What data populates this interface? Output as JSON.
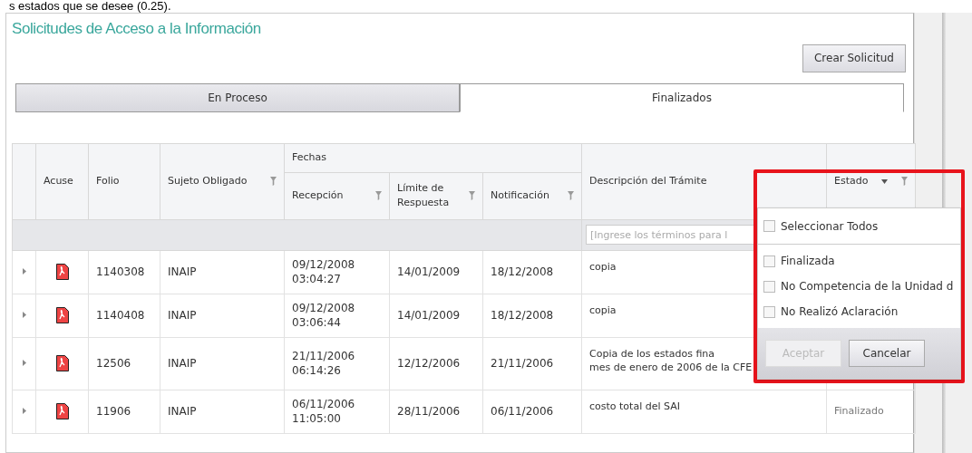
{
  "top_text": "s estados que se desee (0.25).",
  "title": "Solicitudes de Acceso a la Información",
  "create_button": "Crear Solicitud",
  "tabs": [
    {
      "label": "En Proceso",
      "selected": false
    },
    {
      "label": "Finalizados",
      "selected": true
    }
  ],
  "table": {
    "group_header": "Fechas",
    "columns": [
      {
        "label": "Acuse",
        "filter": false
      },
      {
        "label": "Folio",
        "filter": false
      },
      {
        "label": "Sujeto Obligado",
        "filter": true
      },
      {
        "label": "Recepción",
        "filter": true,
        "group": true
      },
      {
        "label": "Límite de Respuesta",
        "filter": true,
        "group": true
      },
      {
        "label": "Notificación",
        "filter": true,
        "group": true
      },
      {
        "label": "Descripción del Trámite",
        "filter": false
      },
      {
        "label": "Estado",
        "filter": true,
        "sort": true
      }
    ],
    "filter_placeholder": "[Ingrese los términos para l",
    "rows": [
      {
        "folio": "1140308",
        "sujeto": "INAIP",
        "recepcion": [
          "09/12/2008",
          "03:04:27"
        ],
        "limite": "14/01/2009",
        "notificacion": "18/12/2008",
        "descripcion": [
          "copia"
        ]
      },
      {
        "folio": "1140408",
        "sujeto": "INAIP",
        "recepcion": [
          "09/12/2008",
          "03:06:44"
        ],
        "limite": "14/01/2009",
        "notificacion": "18/12/2008",
        "descripcion": [
          "copia"
        ]
      },
      {
        "folio": "12506",
        "sujeto": "INAIP",
        "recepcion": [
          "21/11/2006",
          "06:14:26"
        ],
        "limite": "12/12/2006",
        "notificacion": "21/11/2006",
        "descripcion": [
          "Copia de los estados fina",
          "mes de enero de 2006 de la CFE"
        ]
      },
      {
        "folio": "11906",
        "sujeto": "INAIP",
        "recepcion": [
          "06/11/2006",
          "11:05:00"
        ],
        "limite": "28/11/2006",
        "notificacion": "06/11/2006",
        "descripcion": [
          "costo total del SAI"
        ],
        "estado": "Finalizado"
      }
    ]
  },
  "filter_menu": {
    "select_all": {
      "label": "Seleccionar Todos",
      "checked": false
    },
    "options": [
      {
        "label": "Finalizada",
        "checked": false
      },
      {
        "label": "No Competencia de la Unidad d",
        "checked": false
      },
      {
        "label": "No Realizó Aclaración",
        "checked": false
      }
    ],
    "buttons": [
      {
        "label": "Aceptar",
        "disabled": true
      },
      {
        "label": "Cancelar",
        "disabled": false
      }
    ]
  }
}
